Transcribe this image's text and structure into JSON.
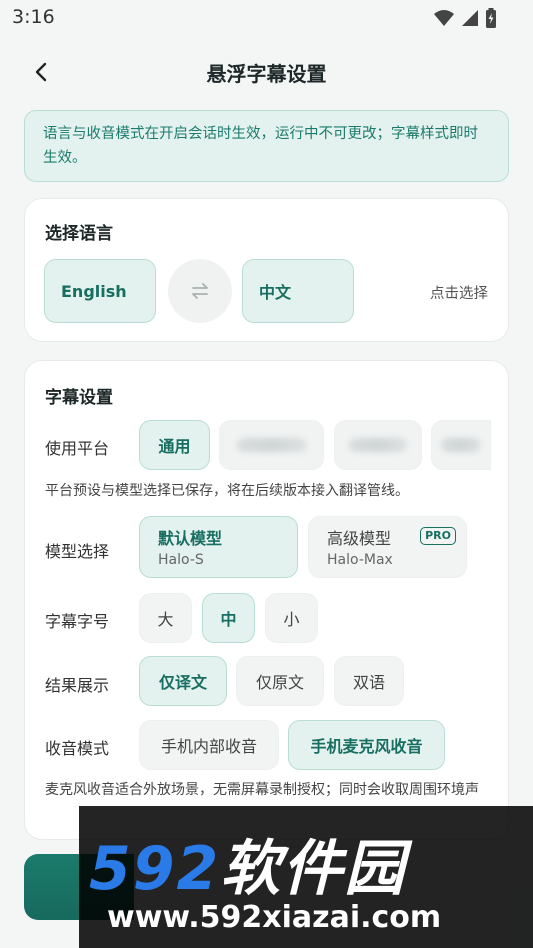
{
  "status_bar": {
    "time": "3:16"
  },
  "header": {
    "title": "悬浮字幕设置"
  },
  "notice": "语言与收音模式在开启会话时生效，运行中不可更改；字幕样式即时生效。",
  "language_card": {
    "title": "选择语言",
    "source_lang": "English",
    "target_lang": "中文",
    "hint": "点击选择"
  },
  "subtitle_card": {
    "title": "字幕设置",
    "platform": {
      "label": "使用平台",
      "options": [
        "通用"
      ],
      "selected": "通用",
      "helper": "平台预设与模型选择已保存，将在后续版本接入翻译管线。"
    },
    "model": {
      "label": "模型选择",
      "options": [
        {
          "name": "默认模型",
          "code": "Halo-S"
        },
        {
          "name": "高级模型",
          "code": "Halo-Max",
          "badge": "PRO"
        }
      ],
      "selected": "默认模型"
    },
    "font_size": {
      "label": "字幕字号",
      "options": [
        "大",
        "中",
        "小"
      ],
      "selected": "中"
    },
    "result": {
      "label": "结果展示",
      "options": [
        "仅译文",
        "仅原文",
        "双语"
      ],
      "selected": "仅译文"
    },
    "capture": {
      "label": "收音模式",
      "options": [
        "手机内部收音",
        "手机麦克风收音"
      ],
      "selected": "手机麦克风收音",
      "helper": "麦克风收音适合外放场景，无需屏幕录制授权；同时会收取周围环境声"
    }
  },
  "watermark": {
    "number": "592",
    "name": "软件园",
    "url": "www.592xiazai.com"
  },
  "colors": {
    "accent": "#186e61",
    "accent_bg": "#e4f2ef",
    "page_bg": "#f4f6f6"
  }
}
